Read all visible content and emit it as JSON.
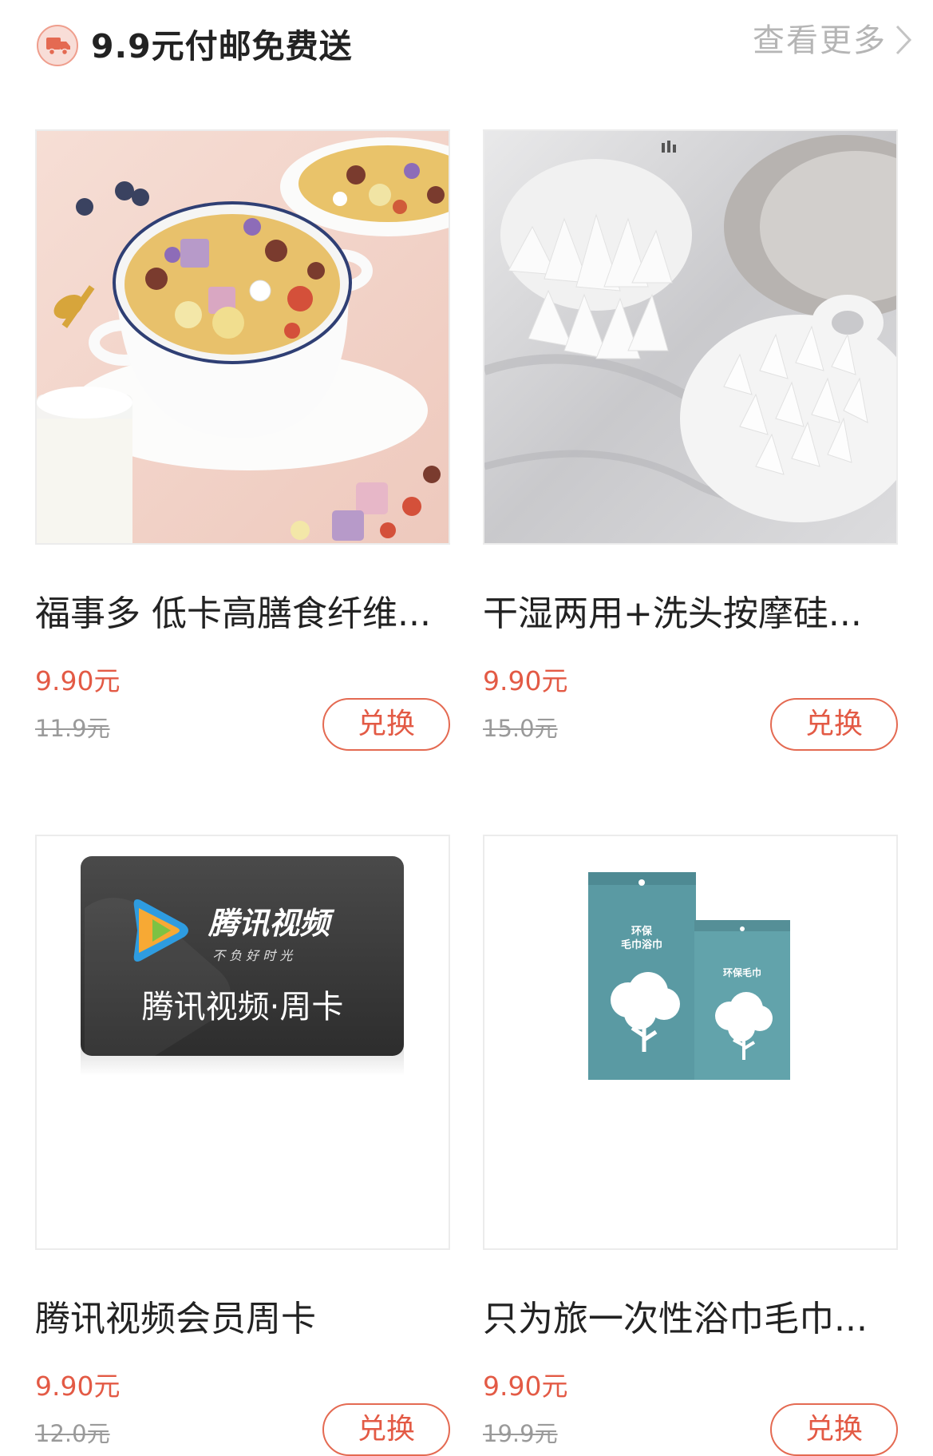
{
  "header": {
    "title": "9.9元付邮免费送",
    "more_label": "查看更多",
    "icon": "truck-icon",
    "chevron_icon": "chevron-right-icon"
  },
  "colors": {
    "accent": "#e35a45",
    "badge_bg": "#f8ddd7"
  },
  "products": [
    {
      "title": "福事多 低卡高膳食纤维...",
      "price": "9.90元",
      "original_price": "11.9元",
      "button": "兑换",
      "image": "cereal-bowl-photo"
    },
    {
      "title": "干湿两用+洗头按摩硅...",
      "price": "9.90元",
      "original_price": "15.0元",
      "button": "兑换",
      "image": "scalp-massager-photo"
    },
    {
      "title": "腾讯视频会员周卡",
      "price": "9.90元",
      "original_price": "12.0元",
      "button": "兑换",
      "image": "tencent-video-card",
      "card_text": {
        "brand": "腾讯视频",
        "slogan": "不 负 好 时 光",
        "card_name": "腾讯视频·周卡"
      }
    },
    {
      "title": "只为旅一次性浴巾毛巾...",
      "price": "9.90元",
      "original_price": "19.9元",
      "button": "兑换",
      "image": "towel-packages-photo",
      "package_text": {
        "big": "环保\n毛巾浴巾",
        "small": "环保毛巾"
      }
    }
  ]
}
